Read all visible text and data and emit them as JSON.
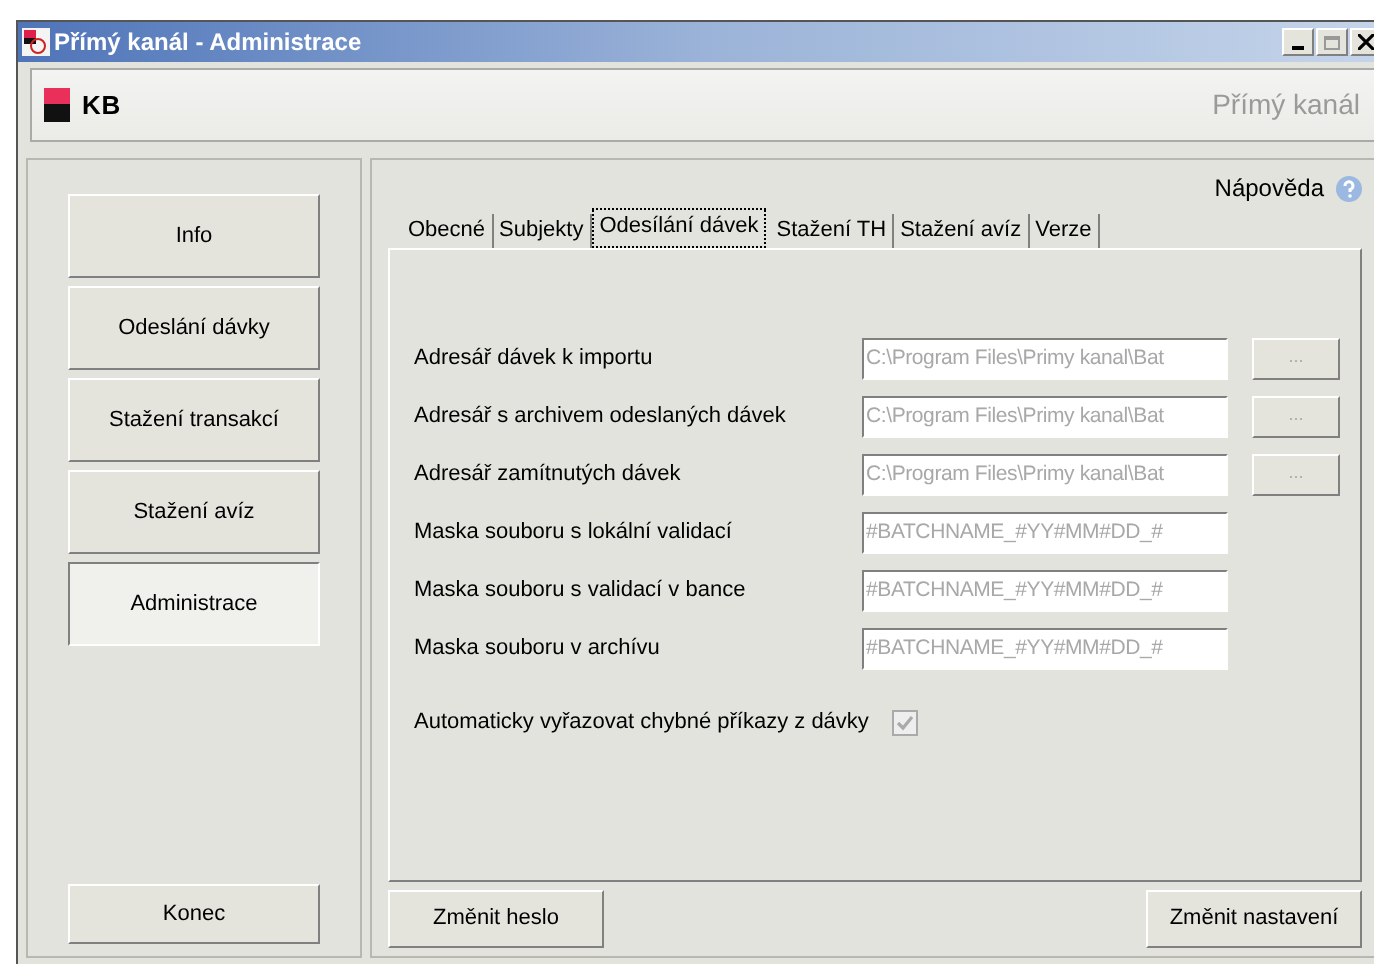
{
  "window": {
    "title": "Přímý kanál - Administrace"
  },
  "header": {
    "logo_text": "KB",
    "product": "Přímý kanál"
  },
  "sidebar": {
    "items": [
      {
        "label": "Info",
        "selected": false
      },
      {
        "label": "Odeslání dávky",
        "selected": false
      },
      {
        "label": "Stažení transakcí",
        "selected": false
      },
      {
        "label": "Stažení avíz",
        "selected": false
      },
      {
        "label": "Administrace",
        "selected": true
      }
    ],
    "exit_button": "Konec"
  },
  "help_link": "Nápověda",
  "tabs": [
    {
      "label": "Obecné",
      "selected": false
    },
    {
      "label": "Subjekty",
      "selected": false
    },
    {
      "label": "Odesílání dávek",
      "selected": true
    },
    {
      "label": "Stažení TH",
      "selected": false
    },
    {
      "label": "Stažení avíz",
      "selected": false
    },
    {
      "label": "Verze",
      "selected": false
    }
  ],
  "fields": [
    {
      "label": "Adresář dávek k importu",
      "value": "C:\\Program Files\\Primy kanal\\Bat",
      "disabled": true,
      "browse_button": "..."
    },
    {
      "label": "Adresář s archivem odeslaných dávek",
      "value": "C:\\Program Files\\Primy kanal\\Bat",
      "disabled": true,
      "browse_button": "..."
    },
    {
      "label": "Adresář zamítnutých dávek",
      "value": "C:\\Program Files\\Primy kanal\\Bat",
      "disabled": true,
      "browse_button": "..."
    },
    {
      "label": "Maska souboru s lokální validací",
      "value": "#BATCHNAME_#YY#MM#DD_#",
      "disabled": true
    },
    {
      "label": "Maska souboru s validací v bance",
      "value": "#BATCHNAME_#YY#MM#DD_#",
      "disabled": true
    },
    {
      "label": "Maska souboru v archívu",
      "value": "#BATCHNAME_#YY#MM#DD_#",
      "disabled": true
    }
  ],
  "auto_remove": {
    "label": "Automaticky vyřazovat chybné příkazy z dávky",
    "checked": true,
    "disabled": true
  },
  "footer_buttons": [
    "Změnit heslo",
    "Změnit nastavení"
  ]
}
